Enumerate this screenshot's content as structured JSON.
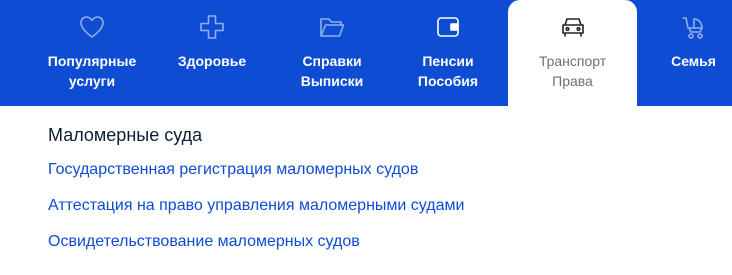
{
  "colors": {
    "brand": "#0d4cd3",
    "link": "#0d4cd3",
    "active_tab_bg": "#ffffff",
    "heading": "#0b1f33"
  },
  "nav": {
    "tabs": [
      {
        "line1": "Популярные",
        "line2": "услуги",
        "icon": "heart-icon",
        "active": false
      },
      {
        "line1": "Здоровье",
        "line2": "",
        "icon": "medical-cross-icon",
        "active": false
      },
      {
        "line1": "Справки",
        "line2": "Выписки",
        "icon": "folder-icon",
        "active": false
      },
      {
        "line1": "Пенсии",
        "line2": "Пособия",
        "icon": "wallet-icon",
        "active": false
      },
      {
        "line1": "Транспорт",
        "line2": "Права",
        "icon": "car-icon",
        "active": true
      },
      {
        "line1": "Семья",
        "line2": "",
        "icon": "stroller-icon",
        "active": false
      }
    ]
  },
  "section": {
    "title": "Маломерные суда",
    "links": [
      "Государственная регистрация маломерных судов",
      "Аттестация на право управления маломерными судами",
      "Освидетельствование маломерных судов"
    ]
  }
}
